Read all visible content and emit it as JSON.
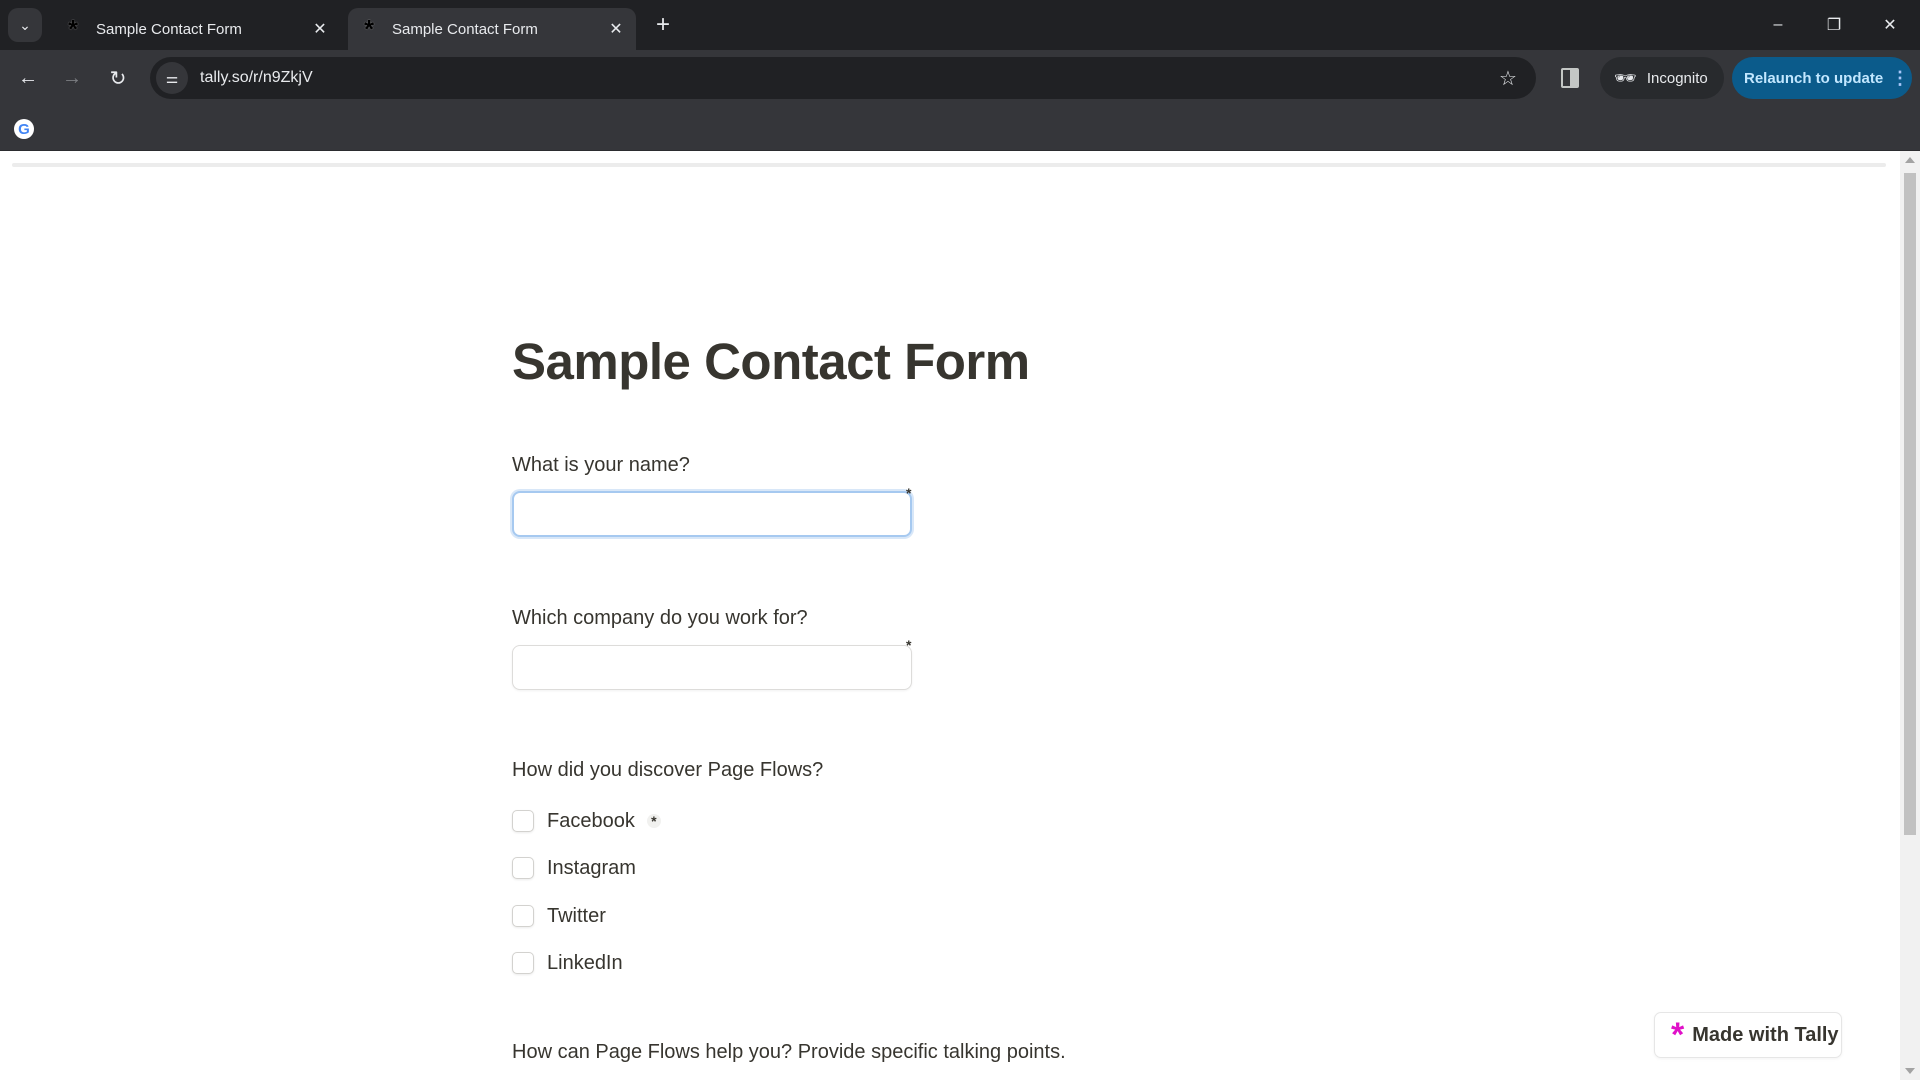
{
  "browser": {
    "tab_search_icon": "chevron-down",
    "tabs": [
      {
        "title": "Sample Contact Form",
        "active": false,
        "favicon": "tally-asterisk"
      },
      {
        "title": "Sample Contact Form",
        "active": true,
        "favicon": "tally-asterisk"
      }
    ],
    "new_tab_label": "+",
    "window_controls": {
      "minimize": "–",
      "restore": "❐",
      "close": "✕"
    },
    "nav": {
      "back": "←",
      "forward": "→",
      "reload": "↻"
    },
    "url": "tally.so/r/n9ZkjV",
    "incognito_label": "Incognito",
    "relaunch_label": "Relaunch to update",
    "bookmarks": [
      {
        "icon": "google-g",
        "label": "G"
      }
    ]
  },
  "form": {
    "title": "Sample Contact Form",
    "questions": [
      {
        "label": "What is your name?",
        "type": "text",
        "value": "",
        "required": true,
        "focused": true
      },
      {
        "label": "Which company do you work for?",
        "type": "text",
        "value": "",
        "required": true,
        "focused": false
      },
      {
        "label": "How did you discover Page Flows?",
        "type": "checkboxes",
        "required": true,
        "options": [
          {
            "label": "Facebook",
            "checked": false
          },
          {
            "label": "Instagram",
            "checked": false
          },
          {
            "label": "Twitter",
            "checked": false
          },
          {
            "label": "LinkedIn",
            "checked": false
          }
        ]
      },
      {
        "label": "How can Page Flows help you? Provide specific talking points.",
        "type": "text"
      }
    ],
    "required_marker": "*"
  },
  "badge": {
    "label": "Made with Tally",
    "accent": "#e010c8"
  },
  "colors": {
    "relaunch_bg": "#0b5b8b",
    "focus_ring": "#a6c9f0",
    "text": "#37352f"
  }
}
